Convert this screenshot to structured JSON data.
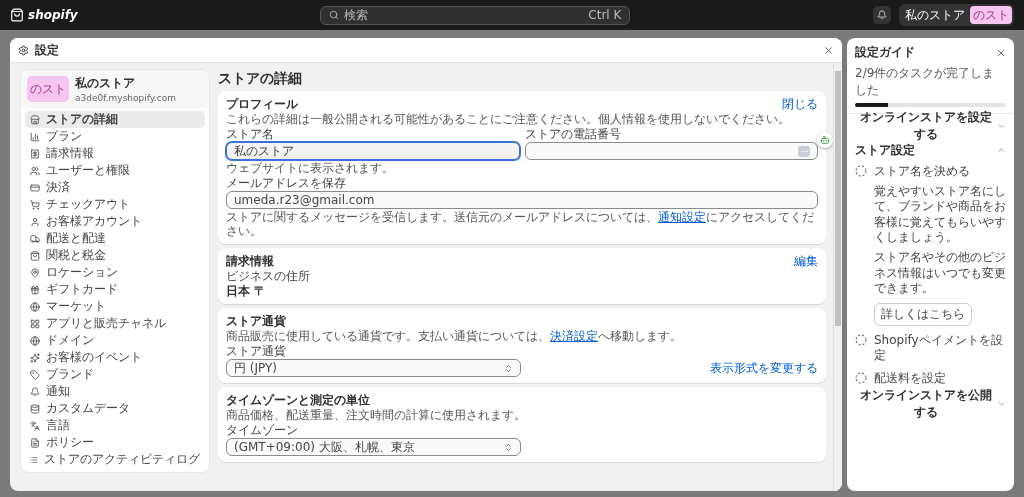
{
  "topbar": {
    "logo": "shopify",
    "search": {
      "placeholder": "検索",
      "shortcut": "Ctrl K"
    },
    "store_name": "私のストア",
    "avatar": "のスト"
  },
  "settings": {
    "title": "設定",
    "store": {
      "avatar": "のスト",
      "name": "私のストア",
      "domain": "a3de0f.myshopify.com"
    },
    "nav": [
      {
        "label": "ストアの詳細",
        "selected": true
      },
      {
        "label": "プラン",
        "selected": false
      },
      {
        "label": "請求情報",
        "selected": false
      },
      {
        "label": "ユーザーと権限",
        "selected": false
      },
      {
        "label": "決済",
        "selected": false
      },
      {
        "label": "チェックアウト",
        "selected": false
      },
      {
        "label": "お客様アカウント",
        "selected": false
      },
      {
        "label": "配送と配達",
        "selected": false
      },
      {
        "label": "関税と税金",
        "selected": false
      },
      {
        "label": "ロケーション",
        "selected": false
      },
      {
        "label": "ギフトカード",
        "selected": false
      },
      {
        "label": "マーケット",
        "selected": false
      },
      {
        "label": "アプリと販売チャネル",
        "selected": false
      },
      {
        "label": "ドメイン",
        "selected": false
      },
      {
        "label": "お客様のイベント",
        "selected": false
      },
      {
        "label": "ブランド",
        "selected": false
      },
      {
        "label": "通知",
        "selected": false
      },
      {
        "label": "カスタムデータ",
        "selected": false
      },
      {
        "label": "言語",
        "selected": false
      },
      {
        "label": "ポリシー",
        "selected": false
      },
      {
        "label": "ストアのアクティビティログ",
        "selected": false
      }
    ],
    "heading": "ストアの詳細",
    "profile": {
      "title": "プロフィール",
      "action": "閉じる",
      "description": "これらの詳細は一般公開される可能性があることにご注意ください。個人情報を使用しないでください。",
      "store_name": {
        "label": "ストア名",
        "value": "私のストア",
        "focused": true,
        "help": "ウェブサイトに表示されます。"
      },
      "phone": {
        "label": "ストアの電話番号"
      },
      "email": {
        "label": "メールアドレスを保存",
        "value": "umeda.r23@gmail.com",
        "help_before": "ストアに関するメッセージを受信します。送信元のメールアドレスについては、",
        "help_link": "通知設定",
        "help_after": "にアクセスしてください。"
      }
    },
    "billing": {
      "title": "請求情報",
      "action": "編集",
      "address_label": "ビジネスの住所",
      "address": "日本 〒"
    },
    "currency": {
      "title": "ストア通貨",
      "description_before": "商品販売に使用している通貨です。支払い通貨については、",
      "description_link": "決済設定",
      "description_after": "へ移動します。",
      "field_label": "ストア通貨",
      "value": "円 (JPY)",
      "action": "表示形式を変更する"
    },
    "timezone": {
      "title": "タイムゾーンと測定の単位",
      "description": "商品価格、配送重量、注文時間の計算に使用されます。",
      "field_label": "タイムゾーン",
      "value": "(GMT+09:00) 大阪、札幌、東京"
    }
  },
  "guide": {
    "title": "設定ガイド",
    "progress_text": "2/9件のタスクが完了しました",
    "level": 0.22,
    "sections": [
      {
        "title": "オンラインストアを設定する",
        "expanded": false
      },
      {
        "title": "ストア設定",
        "expanded": true,
        "tasks": [
          {
            "title": "ストア名を決める",
            "expanded": true,
            "description": "覚えやすいストア名にして、ブランドや商品をお客様に覚えてもらいやすくしましょう。",
            "note": "ストア名やその他のビジネス情報はいつでも変更できます。",
            "button": "詳しくはこちら"
          },
          {
            "title": "Shopifyペイメントを設定",
            "expanded": false
          },
          {
            "title": "配送料を設定",
            "expanded": false
          }
        ]
      },
      {
        "title": "オンラインストアを公開する",
        "expanded": false
      }
    ]
  }
}
